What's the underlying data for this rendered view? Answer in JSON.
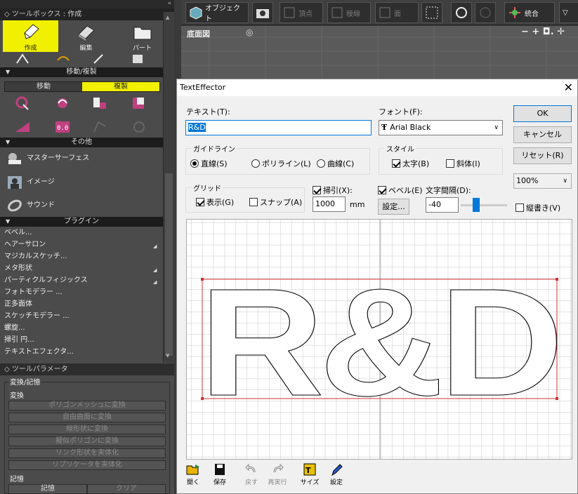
{
  "left_panel": {
    "title": "◇ ツールボックス : 作成",
    "main_tabs": [
      {
        "label": "作成"
      },
      {
        "label": "編集"
      },
      {
        "label": "パート"
      }
    ],
    "section_move": "移動/複製",
    "move_tabs": [
      {
        "label": "移動"
      },
      {
        "label": "複製"
      }
    ],
    "section_other": "その他",
    "other_items": [
      {
        "label": "マスターサーフェス"
      },
      {
        "label": "イメージ"
      },
      {
        "label": "サウンド"
      }
    ],
    "section_plugin": "プラグイン",
    "plugins": [
      {
        "label": "ベベル..."
      },
      {
        "label": "ヘアーサロン"
      },
      {
        "label": "マジカルスケッチ..."
      },
      {
        "label": "メタ形状"
      },
      {
        "label": "パーティクルフィジックス"
      },
      {
        "label": "フォトモデラー ..."
      },
      {
        "label": "正多面体"
      },
      {
        "label": "スケッチモデラー ..."
      },
      {
        "label": "螺旋..."
      },
      {
        "label": "掃引 円..."
      },
      {
        "label": "テキストエフェクタ..."
      }
    ],
    "param_title": "◇ ツールパラメータ",
    "convert_group": "変換/記憶",
    "convert_label": "変換",
    "convert_buttons": [
      {
        "label": "ポリゴンメッシュに変換"
      },
      {
        "label": "自由曲面に変換"
      },
      {
        "label": "線形状に変換"
      },
      {
        "label": "擬似ポリゴンに変換"
      },
      {
        "label": "リンク形状を実体化"
      },
      {
        "label": "リプリケータを実体化"
      }
    ],
    "memory_label": "記憶",
    "memory_buttons": [
      {
        "label": "記憶"
      },
      {
        "label": "クリア"
      }
    ]
  },
  "toolbar": {
    "object": "オブジェクト",
    "vertex": "頂点",
    "edge": "稜線",
    "face": "面",
    "merge": "統合"
  },
  "viewport": {
    "label": "底面図"
  },
  "dialog": {
    "title": "TextEffector",
    "text_label": "テキスト(T):",
    "text_value": "R&D",
    "font_label": "フォント(F):",
    "font_value": "Arial Black",
    "ok": "OK",
    "cancel": "キャンセル",
    "reset": "リセット(R)",
    "zoom": "100%",
    "guideline_group": "ガイドライン",
    "guidelines": [
      {
        "label": "直線(S)",
        "on": true
      },
      {
        "label": "ポリライン(L)",
        "on": false
      },
      {
        "label": "曲線(C)",
        "on": false
      }
    ],
    "style_group": "スタイル",
    "bold": "太字(B)",
    "italic": "斜体(I)",
    "grid_group": "グリッド",
    "grid_show": "表示(G)",
    "grid_snap": "スナップ(A)",
    "sweep_label": "掃引(X):",
    "sweep_value": "1000",
    "sweep_unit": "mm",
    "bevel_label": "ベベル(E)",
    "settings_btn": "設定...",
    "spacing_label": "文字間隔(D):",
    "spacing_value": "-40",
    "vertical": "縦書き(V)",
    "preview_text": "R&D",
    "bottom": [
      {
        "label": "開く"
      },
      {
        "label": "保存"
      },
      {
        "label": "戻す"
      },
      {
        "label": "再実行"
      },
      {
        "label": "サイズ"
      },
      {
        "label": "設定"
      }
    ]
  }
}
